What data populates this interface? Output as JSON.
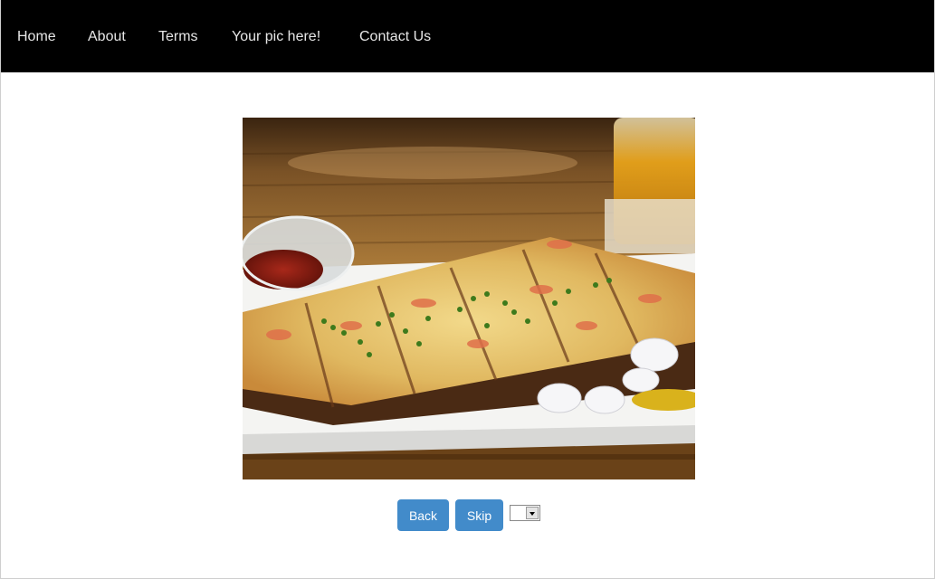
{
  "nav": {
    "items": [
      {
        "label": "Home"
      },
      {
        "label": "About"
      },
      {
        "label": "Terms"
      },
      {
        "label": "Your pic here!"
      },
      {
        "label": "Contact Us"
      }
    ]
  },
  "photo": {
    "subject": "food-photo"
  },
  "controls": {
    "back_label": "Back",
    "skip_label": "Skip",
    "select_value": ""
  },
  "colors": {
    "navbar_bg": "#000000",
    "nav_text": "#e6e6e6",
    "button_bg": "#428bca",
    "button_text": "#ffffff"
  }
}
